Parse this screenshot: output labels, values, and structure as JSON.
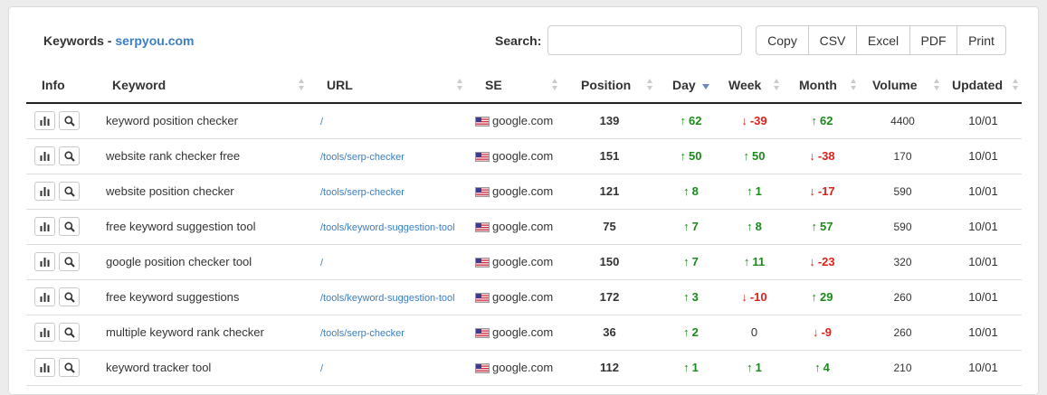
{
  "header": {
    "title_prefix": "Keywords - ",
    "title_domain": "serpyou.com",
    "search_label": "Search:",
    "search_value": "",
    "search_placeholder": ""
  },
  "export_buttons": [
    "Copy",
    "CSV",
    "Excel",
    "PDF",
    "Print"
  ],
  "columns": [
    "Info",
    "Keyword",
    "URL",
    "SE",
    "Position",
    "Day",
    "Week",
    "Month",
    "Volume",
    "Updated"
  ],
  "sorted_column": "Day",
  "colors": {
    "up": "#1a8a1a",
    "down": "#e0211b",
    "link": "#3a7fc1"
  },
  "icons": {
    "chart": "bar-chart-icon",
    "search": "magnifier-icon",
    "flag": "us-flag-icon"
  },
  "rows": [
    {
      "keyword": "keyword position checker",
      "url": "/",
      "se": "google.com",
      "position": "139",
      "day": {
        "dir": "up",
        "value": "62"
      },
      "week": {
        "dir": "down",
        "value": "-39"
      },
      "month": {
        "dir": "up",
        "value": "62"
      },
      "volume": "4400",
      "updated": "10/01"
    },
    {
      "keyword": "website rank checker free",
      "url": "/tools/serp-checker",
      "se": "google.com",
      "position": "151",
      "day": {
        "dir": "up",
        "value": "50"
      },
      "week": {
        "dir": "up",
        "value": "50"
      },
      "month": {
        "dir": "down",
        "value": "-38"
      },
      "volume": "170",
      "updated": "10/01"
    },
    {
      "keyword": "website position checker",
      "url": "/tools/serp-checker",
      "se": "google.com",
      "position": "121",
      "day": {
        "dir": "up",
        "value": "8"
      },
      "week": {
        "dir": "up",
        "value": "1"
      },
      "month": {
        "dir": "down",
        "value": "-17"
      },
      "volume": "590",
      "updated": "10/01"
    },
    {
      "keyword": "free keyword suggestion tool",
      "url": "/tools/keyword-suggestion-tool",
      "se": "google.com",
      "position": "75",
      "day": {
        "dir": "up",
        "value": "7"
      },
      "week": {
        "dir": "up",
        "value": "8"
      },
      "month": {
        "dir": "up",
        "value": "57"
      },
      "volume": "590",
      "updated": "10/01"
    },
    {
      "keyword": "google position checker tool",
      "url": "/",
      "se": "google.com",
      "position": "150",
      "day": {
        "dir": "up",
        "value": "7"
      },
      "week": {
        "dir": "up",
        "value": "11"
      },
      "month": {
        "dir": "down",
        "value": "-23"
      },
      "volume": "320",
      "updated": "10/01"
    },
    {
      "keyword": "free keyword suggestions",
      "url": "/tools/keyword-suggestion-tool",
      "se": "google.com",
      "position": "172",
      "day": {
        "dir": "up",
        "value": "3"
      },
      "week": {
        "dir": "down",
        "value": "-10"
      },
      "month": {
        "dir": "up",
        "value": "29"
      },
      "volume": "260",
      "updated": "10/01"
    },
    {
      "keyword": "multiple keyword rank checker",
      "url": "/tools/serp-checker",
      "se": "google.com",
      "position": "36",
      "day": {
        "dir": "up",
        "value": "2"
      },
      "week": {
        "dir": "none",
        "value": "0"
      },
      "month": {
        "dir": "down",
        "value": "-9"
      },
      "volume": "260",
      "updated": "10/01"
    },
    {
      "keyword": "keyword tracker tool",
      "url": "/",
      "se": "google.com",
      "position": "112",
      "day": {
        "dir": "up",
        "value": "1"
      },
      "week": {
        "dir": "up",
        "value": "1"
      },
      "month": {
        "dir": "up",
        "value": "4"
      },
      "volume": "210",
      "updated": "10/01"
    }
  ]
}
